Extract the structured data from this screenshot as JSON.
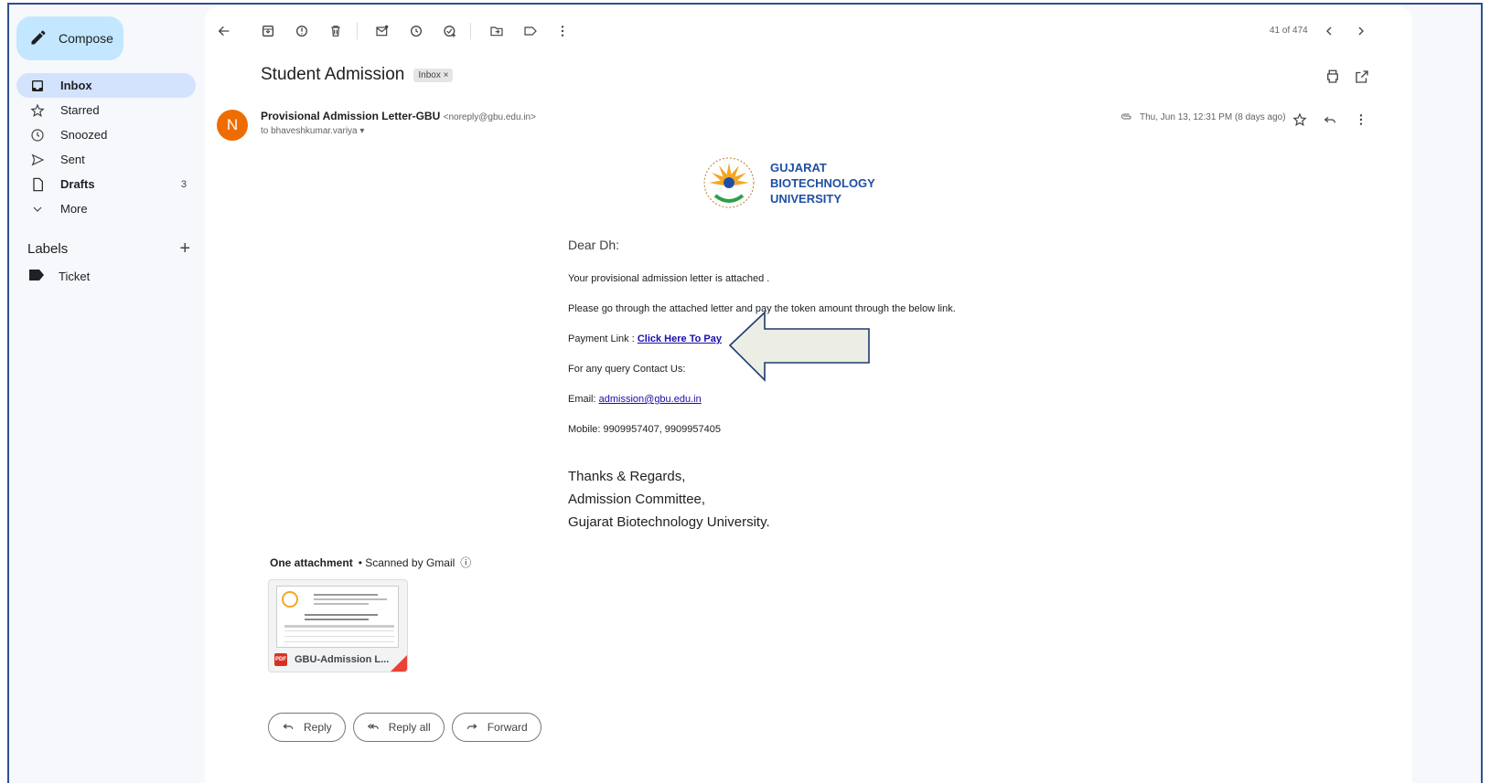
{
  "sidebar": {
    "compose_label": "Compose",
    "items": [
      {
        "label": "Inbox",
        "icon": "inbox-icon",
        "count": ""
      },
      {
        "label": "Starred",
        "icon": "star-icon",
        "count": ""
      },
      {
        "label": "Snoozed",
        "icon": "clock-icon",
        "count": ""
      },
      {
        "label": "Sent",
        "icon": "send-icon",
        "count": ""
      },
      {
        "label": "Drafts",
        "icon": "draft-icon",
        "count": "3"
      },
      {
        "label": "More",
        "icon": "chevron-down-icon",
        "count": ""
      }
    ],
    "labels_title": "Labels",
    "labels": [
      {
        "label": "Ticket",
        "icon": "label-icon"
      }
    ]
  },
  "toolbar": {
    "pager": "41 of 474"
  },
  "email": {
    "subject": "Student Admission",
    "badge": "Inbox ×",
    "sender_name": "Provisional Admission Letter-GBU",
    "sender_email": "<noreply@gbu.edu.in>",
    "to": "to bhaveshkumar.variya",
    "date": "Thu, Jun 13, 12:31 PM (8 days ago)",
    "avatar_letter": "N",
    "logo_lines": [
      "GUJARAT",
      "BIOTECHNOLOGY",
      "UNIVERSITY"
    ],
    "greeting": "Dear Dh:",
    "line1": "Your provisional admission letter is attached .",
    "line2": "Please go through the attached letter and pay the token amount through the below link.",
    "payment_prefix": "Payment Link : ",
    "payment_link": "Click Here To Pay",
    "query": "For any query Contact Us:",
    "email_prefix": "Email: ",
    "email_link": "admission@gbu.edu.in",
    "mobile": "Mobile: 9909957407, 9909957405",
    "sign1": "Thanks & Regards,",
    "sign2": "Admission Committee,",
    "sign3": "Gujarat Biotechnology University."
  },
  "attachment": {
    "heading": "One attachment",
    "scanned": "• Scanned by Gmail",
    "filename": "GBU-Admission L..."
  },
  "actions": {
    "reply": "Reply",
    "reply_all": "Reply all",
    "forward": "Forward"
  },
  "colors": {
    "compose_bg": "#c2e7ff",
    "active_nav": "#d3e3fd",
    "avatar": "#ef6c00",
    "logo_blue": "#1e4fa3",
    "link": "#1a0dab"
  }
}
